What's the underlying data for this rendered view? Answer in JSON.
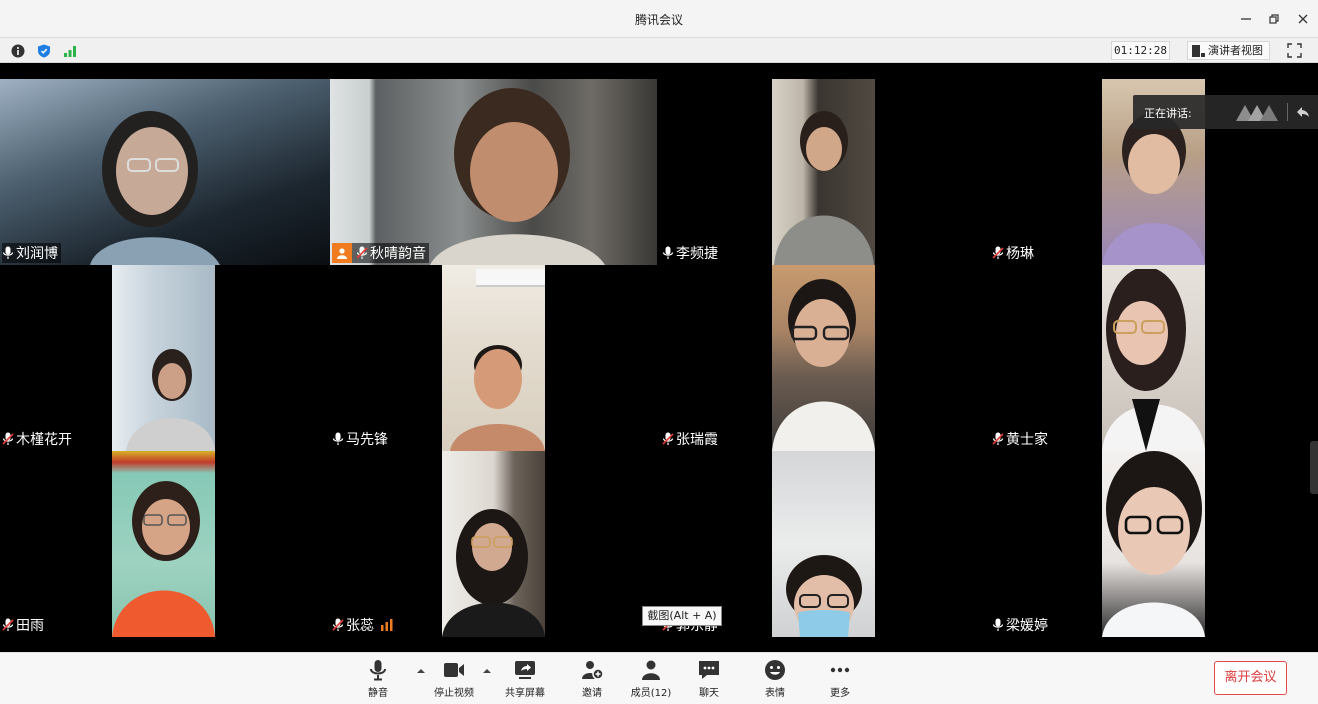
{
  "window": {
    "title": "腾讯会议",
    "minimize_icon": "minimize-icon",
    "restore_icon": "restore-icon",
    "close_icon": "close-icon"
  },
  "infobar": {
    "timer": "01:12:28",
    "speaker_view_label": "演讲者视图",
    "icons": [
      "info-icon",
      "shield-icon",
      "signal-icon",
      "layout-icon",
      "fullscreen-icon"
    ]
  },
  "speaking": {
    "label": "正在讲话:"
  },
  "participants": [
    {
      "name": "刘润博",
      "mic": "on"
    },
    {
      "name": "秋晴韵音",
      "mic": "muted",
      "host": true
    },
    {
      "name": "李频捷",
      "mic": "on"
    },
    {
      "name": "杨琳",
      "mic": "muted"
    },
    {
      "name": "木槿花开",
      "mic": "muted"
    },
    {
      "name": "马先锋",
      "mic": "on"
    },
    {
      "name": "张瑞霞",
      "mic": "muted"
    },
    {
      "name": "黄士家",
      "mic": "muted"
    },
    {
      "name": "田雨",
      "mic": "muted"
    },
    {
      "name": "张蕊",
      "mic": "muted",
      "audio_level": true
    },
    {
      "name": "郭东静",
      "mic": "muted"
    },
    {
      "name": "梁媛婷",
      "mic": "on"
    }
  ],
  "tooltip": "截图(Alt + A)",
  "toolbar": {
    "mute": "静音",
    "stop_video": "停止视频",
    "share_screen": "共享屏幕",
    "invite": "邀请",
    "members": "成员(12)",
    "chat": "聊天",
    "reactions": "表情",
    "more": "更多",
    "leave": "离开会议"
  },
  "colors": {
    "accent_orange": "#f07c1f",
    "leave_red": "#d83b3b",
    "signal_green": "#2cb34a",
    "shield_blue": "#1f7fe0"
  }
}
